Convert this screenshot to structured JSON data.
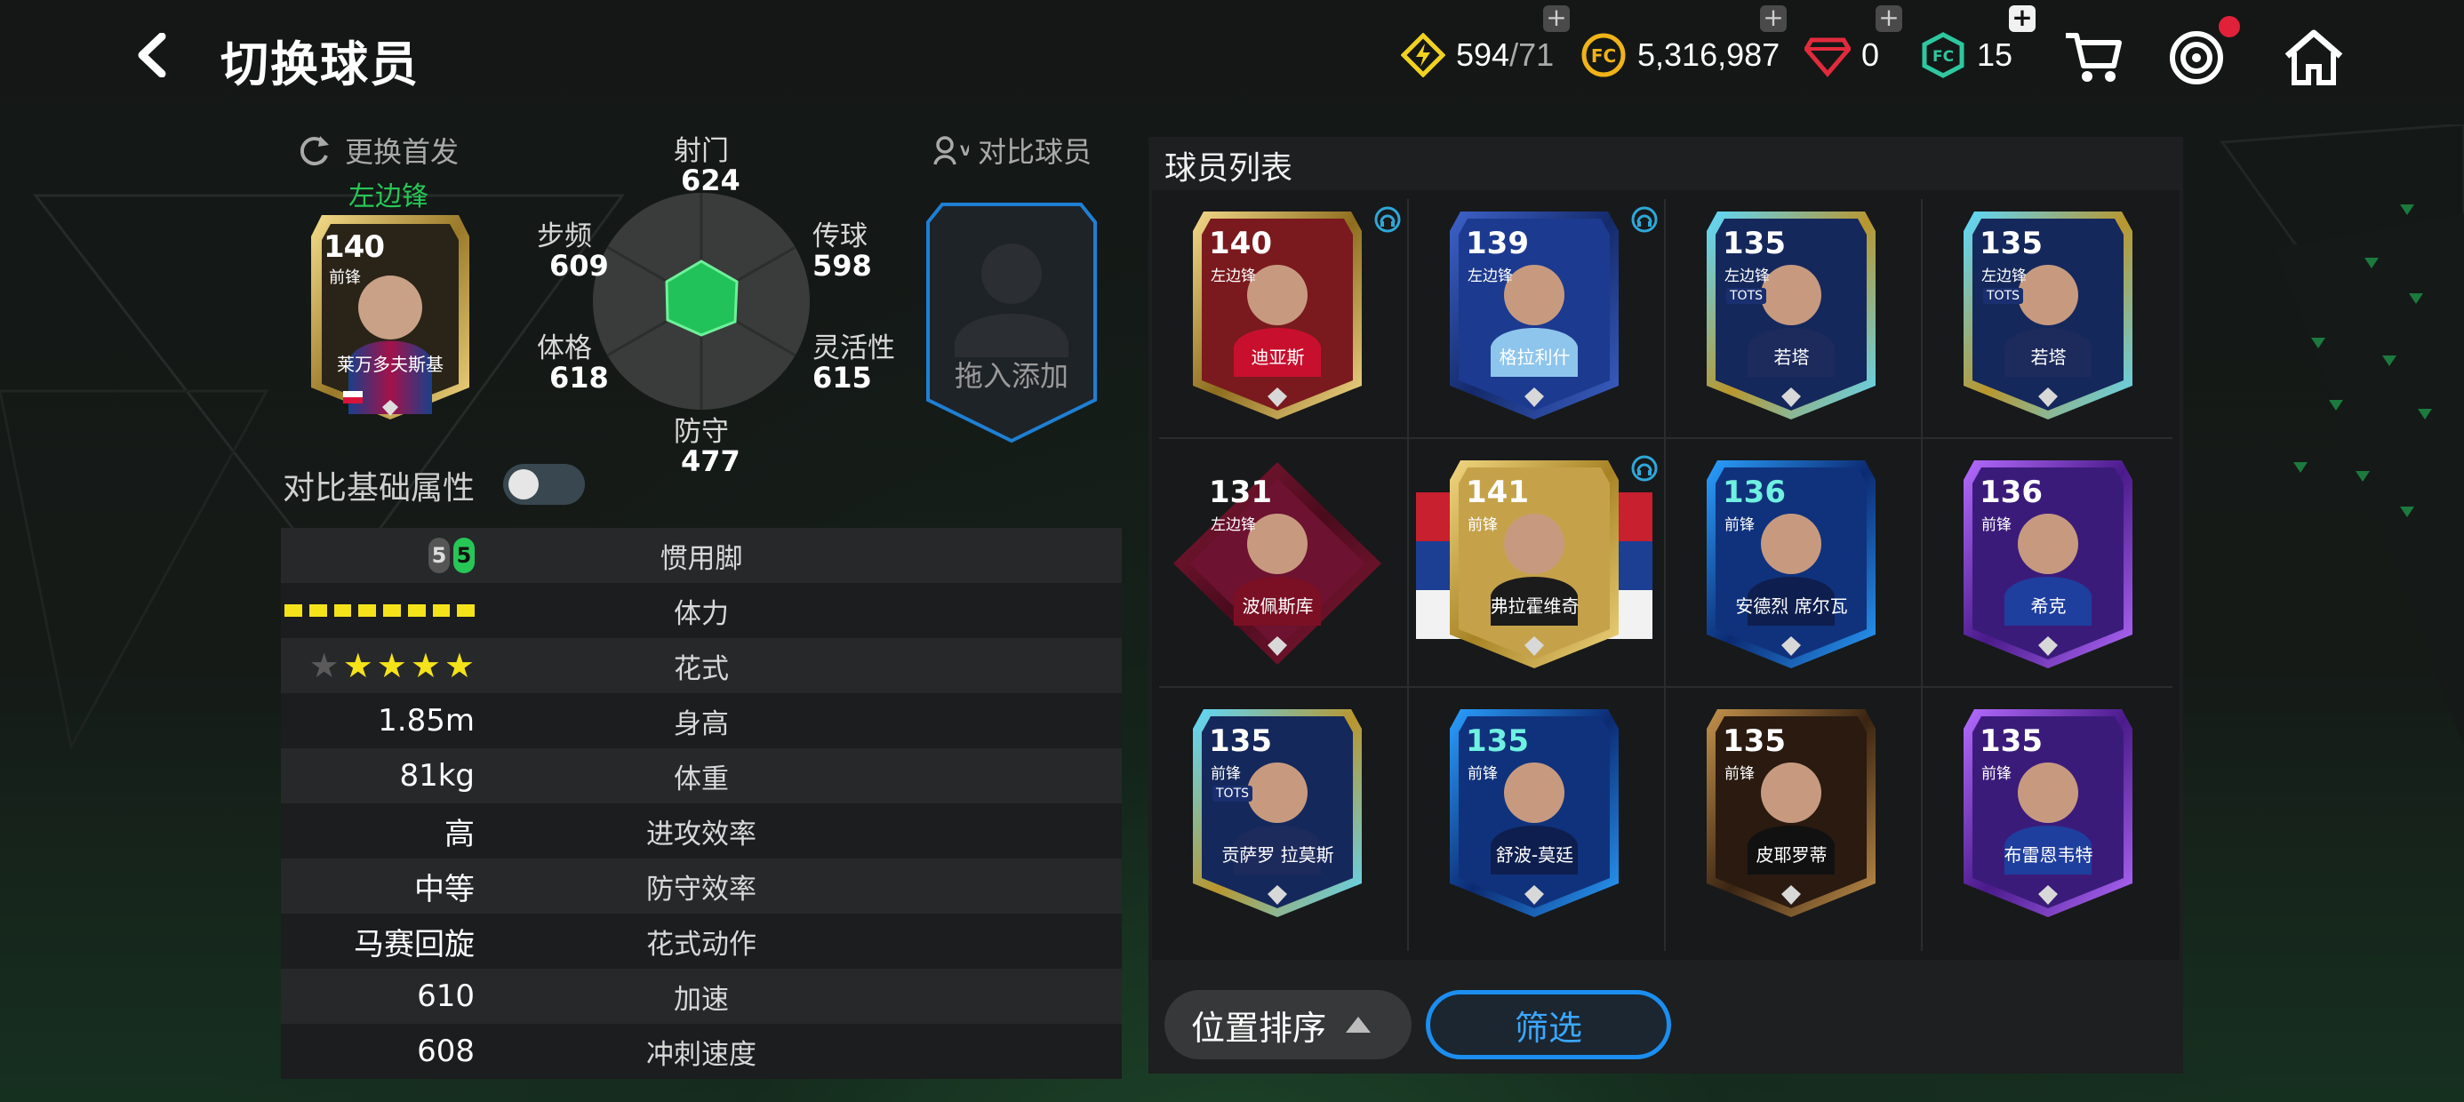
{
  "header": {
    "title": "切换球员",
    "resources": {
      "energy": {
        "value": "594",
        "max": "/71"
      },
      "coins": "5,316,987",
      "gems": "0",
      "fc_points": "15"
    }
  },
  "current_player": {
    "swap_label": "更换首发",
    "position_label": "左边锋",
    "compare_label": "对比球员",
    "card": {
      "rating": "140",
      "position": "前锋",
      "name": "莱万多夫斯基"
    },
    "stats": {
      "shooting": {
        "label": "射门",
        "value": "624"
      },
      "passing": {
        "label": "传球",
        "value": "598"
      },
      "agility": {
        "label": "灵活性",
        "value": "615"
      },
      "defense": {
        "label": "防守",
        "value": "477"
      },
      "physical": {
        "label": "体格",
        "value": "618"
      },
      "pace": {
        "label": "步频",
        "value": "609"
      }
    },
    "drag_add_label": "拖入添加"
  },
  "compare_toggle": {
    "label": "对比基础属性",
    "on": false
  },
  "attributes": [
    {
      "label": "惯用脚",
      "value": "",
      "type": "foot",
      "weak": "5",
      "strong": "5"
    },
    {
      "label": "体力",
      "value": "",
      "type": "stamina",
      "bars": 8
    },
    {
      "label": "花式",
      "value": "",
      "type": "stars",
      "stars": 4,
      "max": 5
    },
    {
      "label": "身高",
      "value": "1.85m"
    },
    {
      "label": "体重",
      "value": "81kg"
    },
    {
      "label": "进攻效率",
      "value": "高"
    },
    {
      "label": "防守效率",
      "value": "中等"
    },
    {
      "label": "花式动作",
      "value": "马赛回旋"
    },
    {
      "label": "加速",
      "value": "610"
    },
    {
      "label": "冲刺速度",
      "value": "608"
    }
  ],
  "player_list": {
    "title": "球员列表",
    "players": [
      {
        "rating": "140",
        "position": "左边锋",
        "name": "迪亚斯",
        "style": "gold",
        "badge": "headphones"
      },
      {
        "rating": "139",
        "position": "左边锋",
        "name": "格拉利什",
        "style": "blue",
        "badge": "headphones"
      },
      {
        "rating": "135",
        "position": "左边锋",
        "name": "若塔",
        "style": "tots",
        "tag": "TOTS"
      },
      {
        "rating": "135",
        "position": "左边锋",
        "name": "若塔",
        "style": "tots",
        "tag": "TOTS"
      },
      {
        "rating": "131",
        "position": "左边锋",
        "name": "波佩斯库",
        "style": "diamond"
      },
      {
        "rating": "141",
        "position": "前锋",
        "name": "弗拉霍维奇",
        "style": "flag",
        "badge": "headphones"
      },
      {
        "rating": "136",
        "position": "前锋",
        "name": "安德烈 席尔瓦",
        "style": "ucl"
      },
      {
        "rating": "136",
        "position": "前锋",
        "name": "希克",
        "style": "purple"
      },
      {
        "rating": "135",
        "position": "前锋",
        "name": "贡萨罗 拉莫斯",
        "style": "tots",
        "tag": "TOTS"
      },
      {
        "rating": "135",
        "position": "前锋",
        "name": "舒波-莫廷",
        "style": "ucl"
      },
      {
        "rating": "135",
        "position": "前锋",
        "name": "皮耶罗蒂",
        "style": "bronze"
      },
      {
        "rating": "135",
        "position": "前锋",
        "name": "布雷恩韦特",
        "style": "purple"
      }
    ]
  },
  "footer": {
    "sort_label": "位置排序",
    "filter_label": "筛选"
  },
  "colors": {
    "accent_green": "#27c657",
    "filter_blue": "#1b8ef0",
    "stamina_yellow": "#f4e31a"
  }
}
